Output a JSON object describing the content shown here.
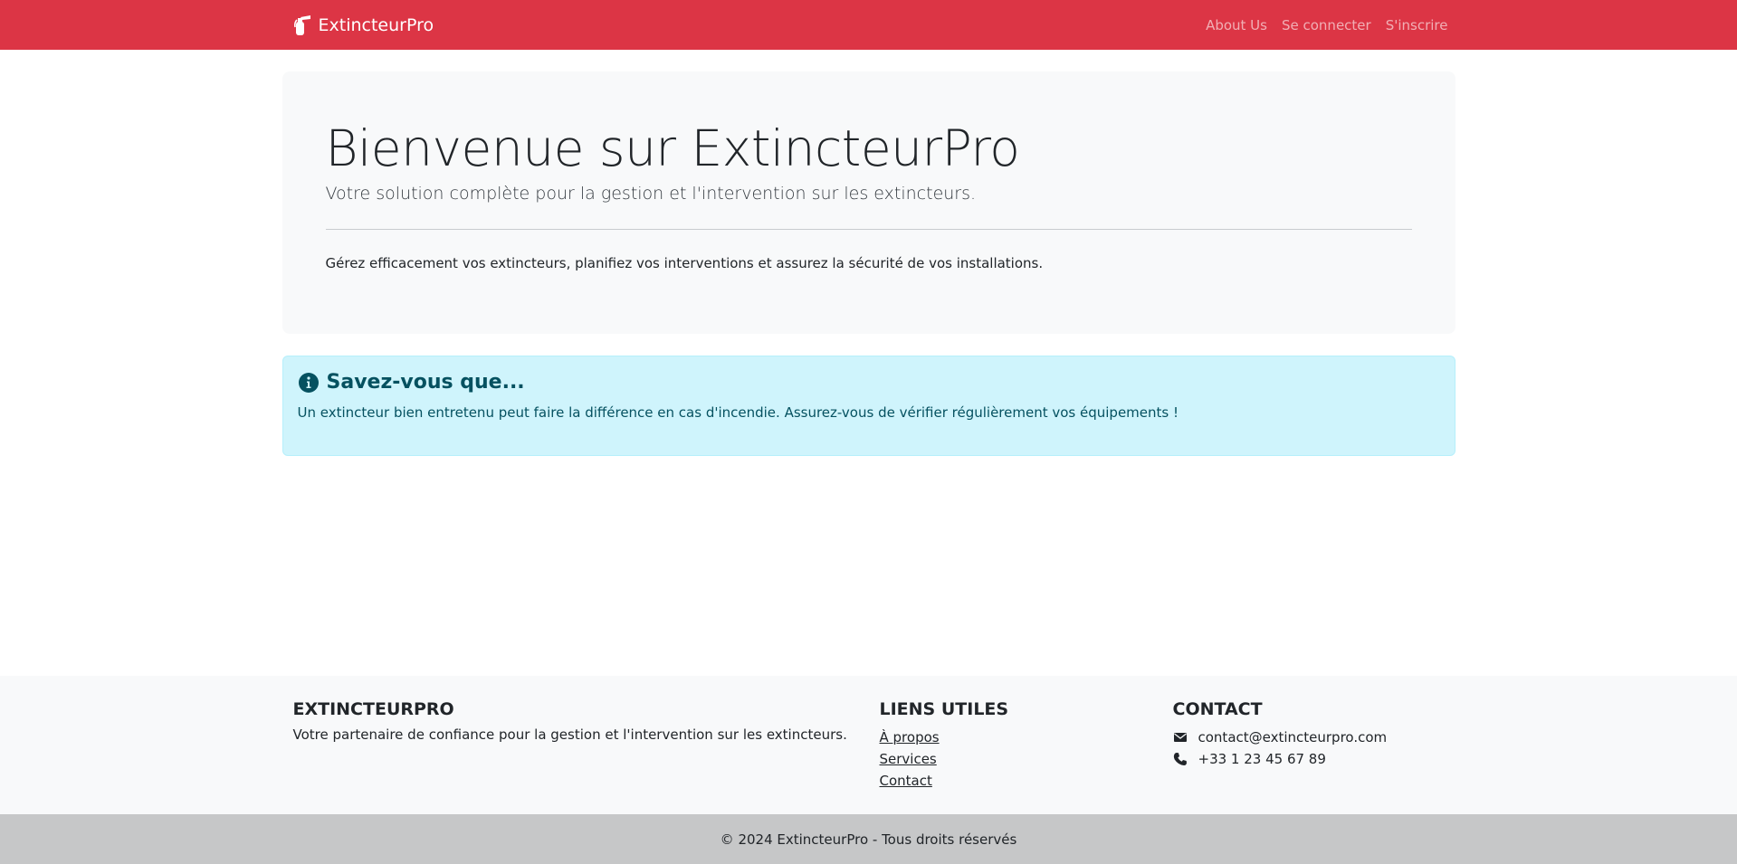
{
  "navbar": {
    "brand": "ExtincteurPro",
    "brand_icon": "fire-extinguisher-icon",
    "links": [
      "About Us",
      "Se connecter",
      "S'inscrire"
    ],
    "color": "#dc3545"
  },
  "hero": {
    "title": "Bienvenue sur ExtincteurPro",
    "lead": "Votre solution complète pour la gestion et l'intervention sur les extincteurs.",
    "text": "Gérez efficacement vos extincteurs, planifiez vos interventions et assurez la sécurité de vos installations."
  },
  "alert": {
    "icon": "info-circle-icon",
    "heading": "Savez-vous que...",
    "text": "Un extincteur bien entretenu peut faire la différence en cas d'incendie. Assurez-vous de vérifier régulièrement vos équipements !",
    "color": "#055160",
    "background": "#cff4fc"
  },
  "footer": {
    "about": {
      "heading": "EXTINCTEURPRO",
      "text": "Votre partenaire de confiance pour la gestion et l'intervention sur les extincteurs."
    },
    "links": {
      "heading": "LIENS UTILES",
      "items": [
        "À propos",
        "Services",
        "Contact"
      ]
    },
    "contact": {
      "heading": "CONTACT",
      "email": "contact@extincteurpro.com",
      "email_icon": "envelope-icon",
      "phone": "+33 1 23 45 67 89",
      "phone_icon": "phone-icon"
    },
    "copyright": "© 2024 ExtincteurPro - Tous droits réservés"
  }
}
